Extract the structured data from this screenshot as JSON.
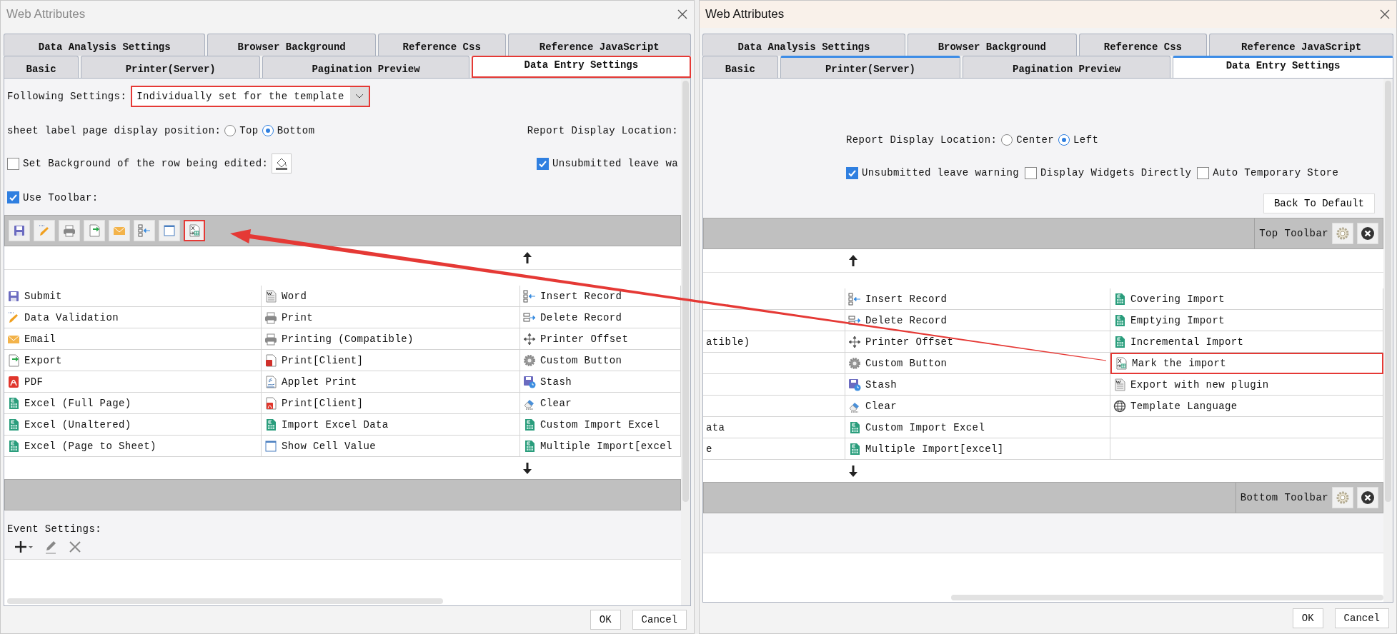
{
  "left_dialog": {
    "title": "Web Attributes",
    "active": false,
    "tab_rows": [
      [
        {
          "label": "Data Analysis Settings",
          "selected": false,
          "accent": false,
          "annotated": false
        },
        {
          "label": "Browser Background",
          "selected": false,
          "accent": false,
          "annotated": false
        },
        {
          "label": "Reference Css",
          "selected": false,
          "accent": false,
          "annotated": false
        },
        {
          "label": "Reference JavaScript",
          "selected": false,
          "accent": false,
          "annotated": false
        }
      ],
      [
        {
          "label": "Basic",
          "selected": false,
          "accent": false,
          "annotated": false
        },
        {
          "label": "Printer(Server)",
          "selected": false,
          "accent": false,
          "annotated": false
        },
        {
          "label": "Pagination Preview",
          "selected": false,
          "accent": false,
          "annotated": false
        },
        {
          "label": "Data Entry Settings",
          "selected": true,
          "accent": true,
          "annotated": true
        }
      ]
    ],
    "following_settings": {
      "label": "Following Settings:",
      "value": "Individually set for the template",
      "annotated": true
    },
    "sheet_label_position": {
      "label": "sheet label page display position:",
      "options": [
        {
          "label": "Top",
          "selected": false
        },
        {
          "label": "Bottom",
          "selected": true
        }
      ]
    },
    "report_display_location": {
      "label": "Report Display Location:"
    },
    "row_background": {
      "label": "Set Background of the row being edited:",
      "checked": false
    },
    "leave_warning": {
      "label": "Unsubmitted leave wa",
      "checked": true
    },
    "use_toolbar": {
      "label": "Use Toolbar:",
      "checked": true
    },
    "toolbar_buttons": [
      {
        "kind": "save",
        "annotated": false
      },
      {
        "kind": "validation",
        "annotated": false
      },
      {
        "kind": "print",
        "annotated": false
      },
      {
        "kind": "export",
        "annotated": false
      },
      {
        "kind": "email",
        "annotated": false
      },
      {
        "kind": "insert",
        "annotated": false
      },
      {
        "kind": "cell",
        "annotated": false
      },
      {
        "kind": "mark",
        "annotated": true
      }
    ],
    "button_grid": [
      [
        {
          "kind": "save",
          "label": "Submit"
        },
        {
          "kind": "validation",
          "label": "Data Validation"
        },
        {
          "kind": "email",
          "label": "Email"
        },
        {
          "kind": "export",
          "label": "Export"
        },
        {
          "kind": "pdf",
          "label": "PDF"
        },
        {
          "kind": "excel",
          "label": "Excel (Full Page)"
        },
        {
          "kind": "excel",
          "label": "Excel (Unaltered)"
        },
        {
          "kind": "excel",
          "label": "Excel (Page to Sheet)"
        }
      ],
      [
        {
          "kind": "word",
          "label": "Word"
        },
        {
          "kind": "print",
          "label": "Print"
        },
        {
          "kind": "print",
          "label": "Printing (Compatible)"
        },
        {
          "kind": "flash",
          "label": "Print[Client]"
        },
        {
          "kind": "applet",
          "label": "Applet Print"
        },
        {
          "kind": "printpdf",
          "label": "Print[Client]"
        },
        {
          "kind": "excel",
          "label": "Import Excel Data"
        },
        {
          "kind": "cell",
          "label": "Show Cell Value"
        }
      ],
      [
        {
          "kind": "insert",
          "label": "Insert Record"
        },
        {
          "kind": "delete",
          "label": "Delete Record"
        },
        {
          "kind": "offset",
          "label": "Printer Offset"
        },
        {
          "kind": "gear",
          "label": "Custom Button"
        },
        {
          "kind": "stash",
          "label": "Stash"
        },
        {
          "kind": "clear",
          "label": "Clear"
        },
        {
          "kind": "excel",
          "label": "Custom Import Excel"
        },
        {
          "kind": "excel",
          "label": "Multiple Import[excel"
        }
      ]
    ],
    "event_settings": {
      "label": "Event Settings:"
    },
    "buttons": [
      "OK",
      "Cancel"
    ]
  },
  "right_dialog": {
    "title": "Web Attributes",
    "active": true,
    "tab_rows": [
      [
        {
          "label": "Data Analysis Settings",
          "selected": false,
          "accent": false,
          "annotated": false
        },
        {
          "label": "Browser Background",
          "selected": false,
          "accent": false,
          "annotated": false
        },
        {
          "label": "Reference Css",
          "selected": false,
          "accent": false,
          "annotated": false
        },
        {
          "label": "Reference JavaScript",
          "selected": false,
          "accent": false,
          "annotated": false
        }
      ],
      [
        {
          "label": "Basic",
          "selected": false,
          "accent": false,
          "annotated": false
        },
        {
          "label": "Printer(Server)",
          "selected": false,
          "accent": true,
          "annotated": false
        },
        {
          "label": "Pagination Preview",
          "selected": false,
          "accent": false,
          "annotated": false
        },
        {
          "label": "Data Entry Settings",
          "selected": true,
          "accent": true,
          "annotated": false
        }
      ]
    ],
    "report_display_location": {
      "label": "Report Display Location:",
      "options": [
        {
          "label": "Center",
          "selected": false
        },
        {
          "label": "Left",
          "selected": true
        }
      ]
    },
    "options": [
      {
        "label": "Unsubmitted leave warning",
        "checked": true
      },
      {
        "label": "Display Widgets Directly",
        "checked": false
      },
      {
        "label": "Auto Temporary Store",
        "checked": false
      }
    ],
    "back_button": "Back To Default",
    "top_toolbar": {
      "label": "Top Toolbar"
    },
    "button_grid": [
      [
        {
          "kind": "blank"
        },
        {
          "kind": "blank"
        },
        {
          "kind": "text",
          "label": "atible)"
        },
        {
          "kind": "blank"
        },
        {
          "kind": "blank"
        },
        {
          "kind": "blank"
        },
        {
          "kind": "text",
          "label": "ata"
        },
        {
          "kind": "text",
          "label": "e"
        }
      ],
      [
        {
          "kind": "insert",
          "label": "Insert Record"
        },
        {
          "kind": "delete",
          "label": "Delete Record"
        },
        {
          "kind": "offset",
          "label": "Printer Offset"
        },
        {
          "kind": "gear",
          "label": "Custom Button"
        },
        {
          "kind": "stash",
          "label": "Stash"
        },
        {
          "kind": "clear",
          "label": "Clear"
        },
        {
          "kind": "excel",
          "label": "Custom Import Excel"
        },
        {
          "kind": "excel",
          "label": "Multiple Import[excel]"
        }
      ],
      [
        {
          "kind": "excel",
          "label": "Covering Import"
        },
        {
          "kind": "excel",
          "label": "Emptying Import"
        },
        {
          "kind": "excel",
          "label": "Incremental Import"
        },
        {
          "kind": "mark",
          "label": "Mark the import",
          "annotated": true
        },
        {
          "kind": "word",
          "label": "Export with new plugin"
        },
        {
          "kind": "globe",
          "label": "Template Language"
        },
        {
          "kind": "blank"
        },
        {
          "kind": "blank"
        }
      ]
    ],
    "bottom_toolbar": {
      "label": "Bottom Toolbar"
    },
    "buttons": [
      "OK",
      "Cancel"
    ]
  }
}
